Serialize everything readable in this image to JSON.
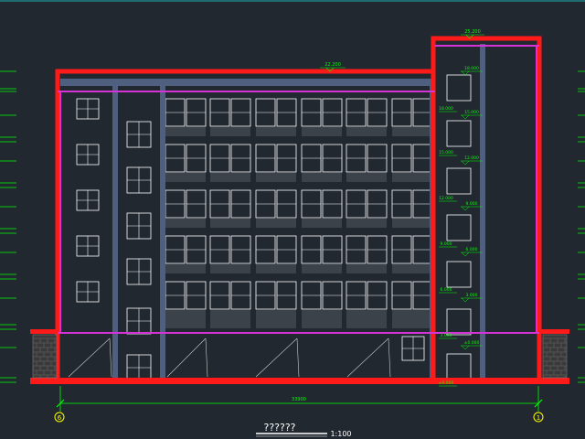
{
  "drawing": {
    "title": "??????",
    "scale": "1:100",
    "overall_dimension": "33900",
    "roof_level_main": "22.200",
    "roof_level_stair": "25.200"
  },
  "axes": {
    "left": "6",
    "right": "1"
  },
  "stair_levels": [
    "18.000",
    "15.000",
    "12.000",
    "9.000",
    "6.000",
    "3.000",
    "±0.000"
  ],
  "colors": {
    "background": "#212830",
    "structure_red": "#ff1a1a",
    "dimension_green": "#00ff00",
    "level_magenta": "#d633d6",
    "column_blue": "#4f5f7f",
    "window_white": "#ffffff",
    "axis_yellow": "#ffff00"
  }
}
